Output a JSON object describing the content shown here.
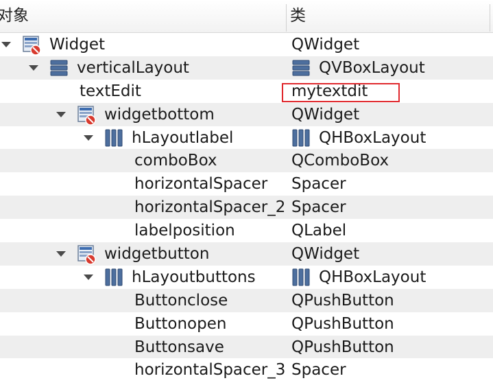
{
  "header": {
    "col_object": "对象",
    "col_class": "类"
  },
  "rows": [
    {
      "name": "Widget",
      "cls": "QWidget",
      "indent": 0,
      "expander": true,
      "icon": "widget-icon",
      "clsIcon": "",
      "alt": false
    },
    {
      "name": "verticalLayout",
      "cls": "QVBoxLayout",
      "indent": 1,
      "expander": true,
      "icon": "vbox-layout-icon",
      "clsIcon": "vbox-layout-icon",
      "alt": true
    },
    {
      "name": "textEdit",
      "cls": "mytextdit",
      "indent": 2,
      "expander": false,
      "icon": "",
      "clsIcon": "",
      "alt": false
    },
    {
      "name": "widgetbottom",
      "cls": "QWidget",
      "indent": 2,
      "expander": true,
      "icon": "widget-icon",
      "clsIcon": "",
      "alt": true
    },
    {
      "name": "hLayoutlabel",
      "cls": "QHBoxLayout",
      "indent": 3,
      "expander": true,
      "icon": "hbox-layout-icon",
      "clsIcon": "hbox-layout-icon",
      "alt": false
    },
    {
      "name": "comboBox",
      "cls": "QComboBox",
      "indent": 4,
      "expander": false,
      "icon": "",
      "clsIcon": "",
      "alt": true
    },
    {
      "name": "horizontalSpacer",
      "cls": "Spacer",
      "indent": 4,
      "expander": false,
      "icon": "",
      "clsIcon": "",
      "alt": false
    },
    {
      "name": "horizontalSpacer_2",
      "cls": "Spacer",
      "indent": 4,
      "expander": false,
      "icon": "",
      "clsIcon": "",
      "alt": true
    },
    {
      "name": "labelposition",
      "cls": "QLabel",
      "indent": 4,
      "expander": false,
      "icon": "",
      "clsIcon": "",
      "alt": false
    },
    {
      "name": "widgetbutton",
      "cls": "QWidget",
      "indent": 2,
      "expander": true,
      "icon": "widget-icon",
      "clsIcon": "",
      "alt": true
    },
    {
      "name": "hLayoutbuttons",
      "cls": "QHBoxLayout",
      "indent": 3,
      "expander": true,
      "icon": "hbox-layout-icon",
      "clsIcon": "hbox-layout-icon",
      "alt": false
    },
    {
      "name": "Buttonclose",
      "cls": "QPushButton",
      "indent": 4,
      "expander": false,
      "icon": "",
      "clsIcon": "",
      "alt": true
    },
    {
      "name": "Buttonopen",
      "cls": "QPushButton",
      "indent": 4,
      "expander": false,
      "icon": "",
      "clsIcon": "",
      "alt": false
    },
    {
      "name": "Buttonsave",
      "cls": "QPushButton",
      "indent": 4,
      "expander": false,
      "icon": "",
      "clsIcon": "",
      "alt": true
    },
    {
      "name": "horizontalSpacer_3",
      "cls": "Spacer",
      "indent": 4,
      "expander": false,
      "icon": "",
      "clsIcon": "",
      "alt": false
    }
  ],
  "highlight_color": "#e0282d"
}
